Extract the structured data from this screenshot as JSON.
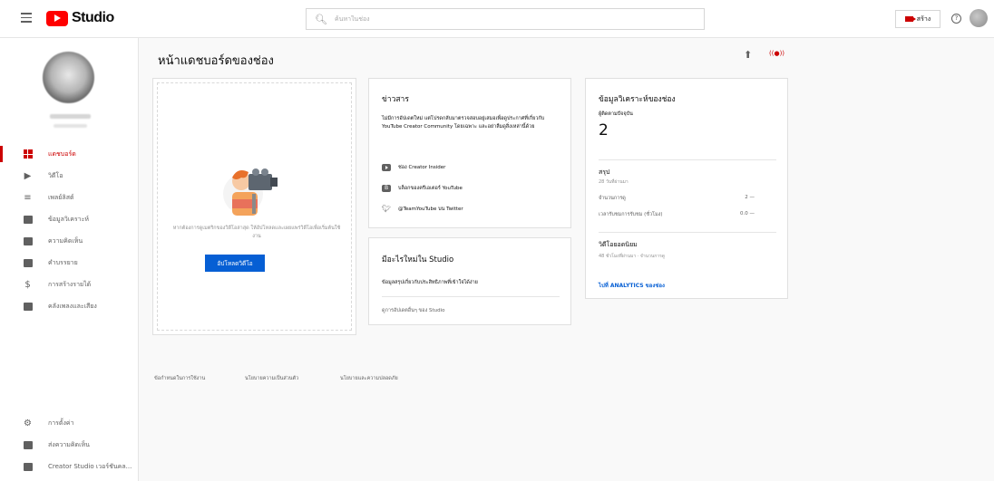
{
  "header": {
    "app_name": "Studio",
    "search_placeholder": "ค้นหาในช่อง",
    "create_label": "สร้าง"
  },
  "sidebar": {
    "items": [
      {
        "label": "แดชบอร์ด",
        "icon": "dashboard-icon",
        "active": true
      },
      {
        "label": "วิดีโอ",
        "icon": "video-icon"
      },
      {
        "label": "เพลย์ลิสต์",
        "icon": "playlist-icon"
      },
      {
        "label": "ข้อมูลวิเคราะห์",
        "icon": "analytics-icon"
      },
      {
        "label": "ความคิดเห็น",
        "icon": "comment-icon"
      },
      {
        "label": "คำบรรยาย",
        "icon": "subtitles-icon"
      },
      {
        "label": "การสร้างรายได้",
        "icon": "monetization-icon"
      },
      {
        "label": "คลังเพลงและเสียง",
        "icon": "audio-library-icon"
      }
    ],
    "bottom_items": [
      {
        "label": "การตั้งค่า",
        "icon": "settings-icon"
      },
      {
        "label": "ส่งความคิดเห็น",
        "icon": "feedback-icon"
      },
      {
        "label": "Creator Studio เวอร์ชันคล...",
        "icon": "classic-studio-icon"
      }
    ]
  },
  "main": {
    "title": "หน้าแดชบอร์ดของช่อง"
  },
  "upload_card": {
    "text": "หากต้องการดูเมตริกของวิดีโอล่าสุด ให้อัปโหลดและเผยแพร่วิดีโอเพื่อเริ่มต้นใช้งาน",
    "button_label": "อัปโหลดวิดีโอ"
  },
  "news_card": {
    "title": "ข่าวสาร",
    "body": "ไม่มีการอัปเดตใหม่ แต่โปรดกลับมาตรวจสอบอยู่เสมอเพื่อดูประกาศที่เกี่ยวกับ YouTube Creator Community โดยเฉพาะ และอย่าลืมดูสิ่งเหล่านี้ด้วย",
    "links": [
      {
        "label": "ช่อง Creator Insider",
        "icon": "youtube-icon"
      },
      {
        "label": "บล็อกของครีเอเตอร์ YouTube",
        "icon": "blogger-icon"
      },
      {
        "label": "@TeamYouTube บน Twitter",
        "icon": "twitter-icon"
      }
    ]
  },
  "whats_new_card": {
    "title": "มีอะไรใหม่ใน Studio",
    "description": "ข้อมูลสรุปเกี่ยวกับประสิทธิภาพที่เข้าใจได้ง่าย",
    "link": "ดูการอัปเดตอื่นๆ ของ Studio"
  },
  "analytics_card": {
    "title": "ข้อมูลวิเคราะห์ของช่อง",
    "subscribers_label": "ผู้ติดตามปัจจุบัน",
    "subscribers_value": "2",
    "summary_title": "สรุป",
    "summary_period": "28 วันที่ผ่านมา",
    "rows": [
      {
        "label": "จำนวนการดู",
        "value": "2 —"
      },
      {
        "label": "เวลารับชมการรับชม (ชั่วโมง)",
        "value": "0.0 —"
      }
    ],
    "top_videos_title": "วิดีโอยอดนิยม",
    "top_videos_period": "48 ชั่วโมงที่ผ่านมา · จำนวนการดู",
    "link": "ไปที่ ANALYTICS ของช่อง"
  },
  "footer": {
    "links": [
      "ข้อกำหนดในการใช้งาน",
      "นโยบายความเป็นส่วนตัว",
      "นโยบายและความปลอดภัย"
    ]
  },
  "colors": {
    "accent": "#cc0000",
    "link": "#065fd4",
    "brand": "#ff0000"
  }
}
